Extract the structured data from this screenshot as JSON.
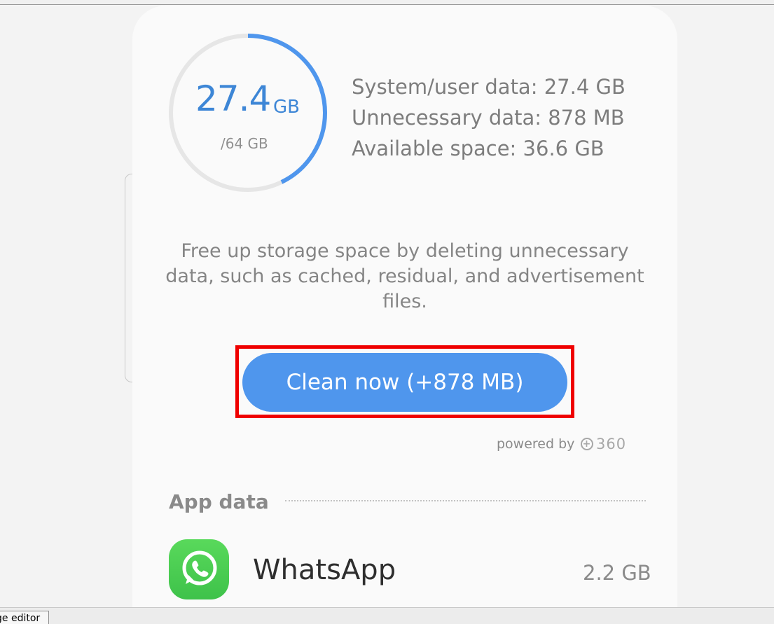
{
  "storage": {
    "used_value": "27.4",
    "used_unit": "GB",
    "total_caption": "/64 GB",
    "used_fraction": 0.428,
    "ring_color": "#4f96ed",
    "track_color": "#e6e6e6",
    "stats": [
      "System/user data: 27.4 GB",
      "Unnecessary data: 878 MB",
      "Available space: 36.6 GB"
    ]
  },
  "description": "Free up storage space by deleting unnecessary data, such as cached, residual, and advertisement files.",
  "clean_button": {
    "label": "Clean now (+878 MB)",
    "color": "#4f96ed",
    "highlight_color": "#ef0000"
  },
  "powered_by": {
    "label": "powered by",
    "logo_text": "360"
  },
  "app_data": {
    "title": "App data",
    "items": [
      {
        "name": "WhatsApp",
        "size": "2.2 GB",
        "icon": "whatsapp-icon"
      }
    ]
  },
  "taskbar": {
    "tab_label": "ge editor"
  }
}
